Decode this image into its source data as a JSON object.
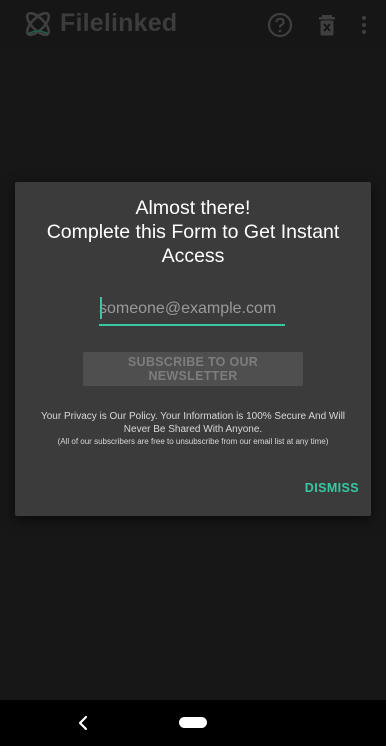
{
  "appbar": {
    "title": "Filelinked",
    "icons": [
      "logo-icon",
      "help-icon",
      "trash-icon",
      "more-vert-icon"
    ]
  },
  "dialog": {
    "title_line1": "Almost there!",
    "title_line2": "Complete this Form to Get Instant Access",
    "email_placeholder": "someone@example.com",
    "email_value": "",
    "subscribe_label": "SUBSCRIBE TO OUR NEWSLETTER",
    "privacy_text": "Your Privacy is Our Policy. Your Information is 100% Secure And Will Never Be Shared With Anyone.",
    "unsubscribe_note": "(All of our subscribers are free to unsubscribe from our email list at any time)",
    "dismiss_label": "DISMISS"
  },
  "navbar": {
    "icons": [
      "back-icon",
      "home-pill-icon"
    ]
  },
  "colors": {
    "accent": "#37c8a2",
    "dialog_bg": "#3b3b3b",
    "screen_bg": "#171717"
  }
}
